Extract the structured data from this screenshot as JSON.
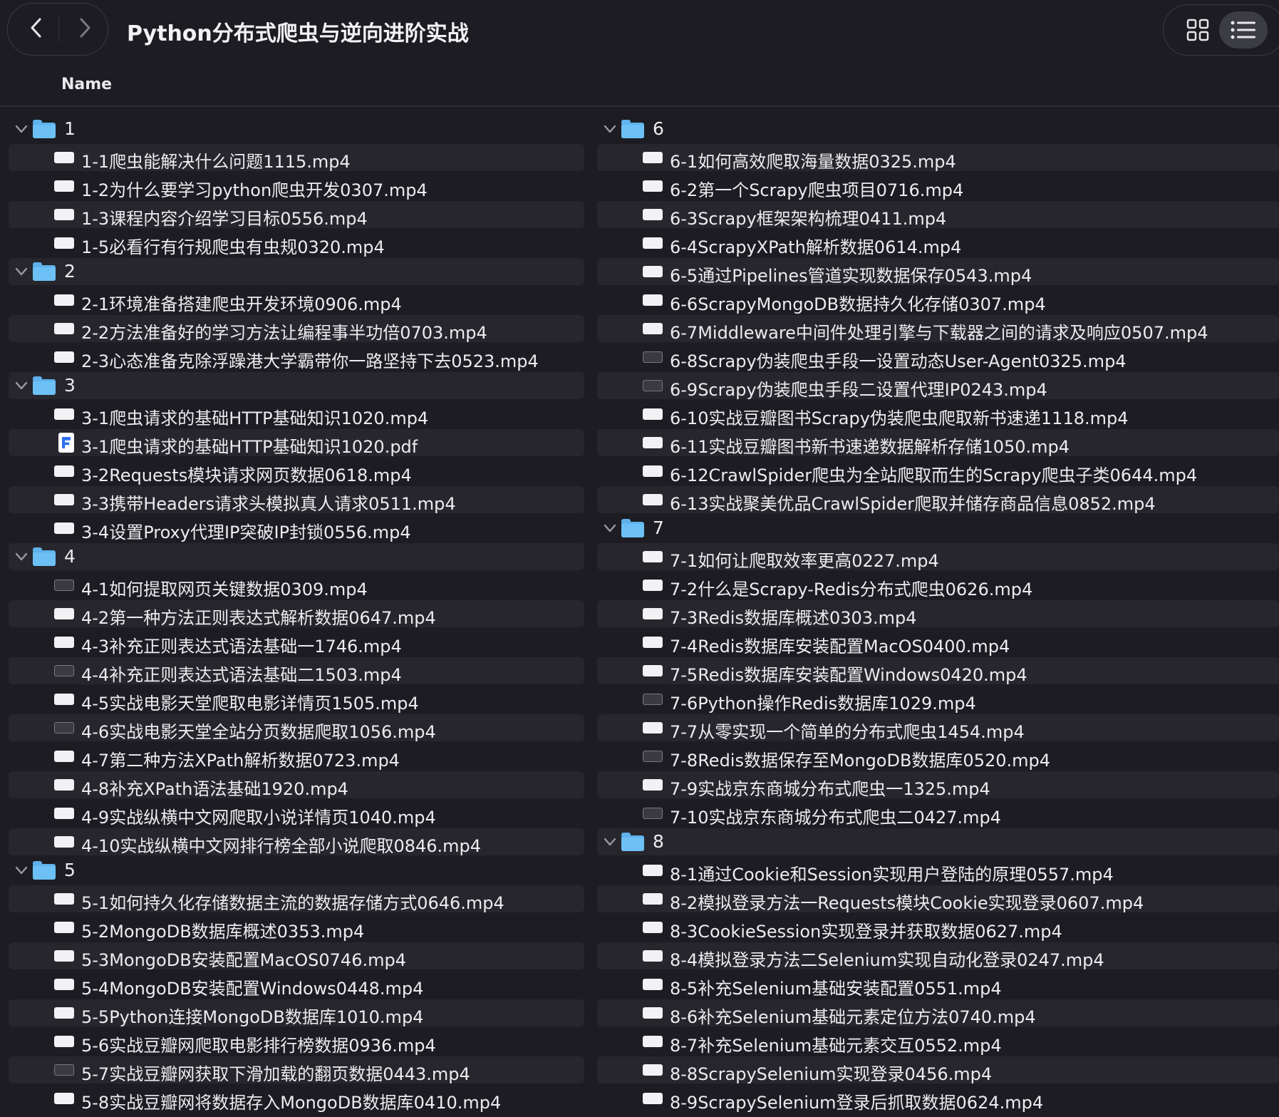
{
  "window": {
    "title": "Python分布式爬虫与逆向进阶实战"
  },
  "toolbar": {
    "back_icon": "chevron-left-icon",
    "forward_icon": "chevron-right-icon",
    "grid_view_icon": "grid-view-icon",
    "list_view_icon": "list-view-icon"
  },
  "columns": {
    "name": "Name"
  },
  "colors": {
    "folder": "#6cc0f5",
    "background": "#1c1c22",
    "row_alt": "#26262c"
  },
  "left_rows": [
    {
      "type": "folder",
      "label": "1"
    },
    {
      "type": "file",
      "label": "1-1爬虫能解决什么问题1115.mp4"
    },
    {
      "type": "file",
      "label": "1-2为什么要学习python爬虫开发0307.mp4"
    },
    {
      "type": "file",
      "label": "1-3课程内容介绍学习目标0556.mp4"
    },
    {
      "type": "file",
      "label": "1-5必看行有行规爬虫有虫规0320.mp4"
    },
    {
      "type": "folder",
      "label": "2"
    },
    {
      "type": "file",
      "label": "2-1环境准备搭建爬虫开发环境0906.mp4"
    },
    {
      "type": "file",
      "label": "2-2方法准备好的学习方法让编程事半功倍0703.mp4"
    },
    {
      "type": "file",
      "label": "2-3心态准备克除浮躁港大学霸带你一路坚持下去0523.mp4"
    },
    {
      "type": "folder",
      "label": "3"
    },
    {
      "type": "file",
      "label": "3-1爬虫请求的基础HTTP基础知识1020.mp4"
    },
    {
      "type": "pdf",
      "label": "3-1爬虫请求的基础HTTP基础知识1020.pdf"
    },
    {
      "type": "file",
      "label": "3-2Requests模块请求网页数据0618.mp4"
    },
    {
      "type": "file",
      "label": "3-3携带Headers请求头模拟真人请求0511.mp4"
    },
    {
      "type": "file",
      "label": "3-4设置Proxy代理IP突破IP封锁0556.mp4"
    },
    {
      "type": "folder",
      "label": "4"
    },
    {
      "type": "file-dark",
      "label": "4-1如何提取网页关键数据0309.mp4"
    },
    {
      "type": "file",
      "label": "4-2第一种方法正则表达式解析数据0647.mp4"
    },
    {
      "type": "file",
      "label": "4-3补充正则表达式语法基础一1746.mp4"
    },
    {
      "type": "file-dark",
      "label": "4-4补充正则表达式语法基础二1503.mp4"
    },
    {
      "type": "file",
      "label": "4-5实战电影天堂爬取电影详情页1505.mp4"
    },
    {
      "type": "file-dark",
      "label": "4-6实战电影天堂全站分页数据爬取1056.mp4"
    },
    {
      "type": "file",
      "label": "4-7第二种方法XPath解析数据0723.mp4"
    },
    {
      "type": "file",
      "label": "4-8补充XPath语法基础1920.mp4"
    },
    {
      "type": "file",
      "label": "4-9实战纵横中文网爬取小说详情页1040.mp4"
    },
    {
      "type": "file",
      "label": "4-10实战纵横中文网排行榜全部小说爬取0846.mp4"
    },
    {
      "type": "folder",
      "label": "5"
    },
    {
      "type": "file",
      "label": "5-1如何持久化存储数据主流的数据存储方式0646.mp4"
    },
    {
      "type": "file",
      "label": "5-2MongoDB数据库概述0353.mp4"
    },
    {
      "type": "file",
      "label": "5-3MongoDB安装配置MacOS0746.mp4"
    },
    {
      "type": "file",
      "label": "5-4MongoDB安装配置Windows0448.mp4"
    },
    {
      "type": "file",
      "label": "5-5Python连接MongoDB数据库1010.mp4"
    },
    {
      "type": "file",
      "label": "5-6实战豆瓣网爬取电影排行榜数据0936.mp4"
    },
    {
      "type": "file-dark",
      "label": "5-7实战豆瓣网获取下滑加载的翻页数据0443.mp4"
    },
    {
      "type": "file",
      "label": "5-8实战豆瓣网将数据存入MongoDB数据库0410.mp4"
    }
  ],
  "right_rows": [
    {
      "type": "folder",
      "label": "6"
    },
    {
      "type": "file",
      "label": "6-1如何高效爬取海量数据0325.mp4"
    },
    {
      "type": "file",
      "label": "6-2第一个Scrapy爬虫项目0716.mp4"
    },
    {
      "type": "file",
      "label": "6-3Scrapy框架架构梳理0411.mp4"
    },
    {
      "type": "file",
      "label": "6-4ScrapyXPath解析数据0614.mp4"
    },
    {
      "type": "file",
      "label": "6-5通过Pipelines管道实现数据保存0543.mp4"
    },
    {
      "type": "file",
      "label": "6-6ScrapyMongoDB数据持久化存储0307.mp4"
    },
    {
      "type": "file",
      "label": "6-7Middleware中间件处理引擎与下载器之间的请求及响应0507.mp4"
    },
    {
      "type": "file-dark",
      "label": "6-8Scrapy伪装爬虫手段一设置动态User-Agent0325.mp4"
    },
    {
      "type": "file-dark",
      "label": "6-9Scrapy伪装爬虫手段二设置代理IP0243.mp4"
    },
    {
      "type": "file",
      "label": "6-10实战豆瓣图书Scrapy伪装爬虫爬取新书速递1118.mp4"
    },
    {
      "type": "file",
      "label": "6-11实战豆瓣图书新书速递数据解析存储1050.mp4"
    },
    {
      "type": "file",
      "label": "6-12CrawlSpider爬虫为全站爬取而生的Scrapy爬虫子类0644.mp4"
    },
    {
      "type": "file",
      "label": "6-13实战聚美优品CrawlSpider爬取并储存商品信息0852.mp4"
    },
    {
      "type": "folder",
      "label": "7"
    },
    {
      "type": "file",
      "label": "7-1如何让爬取效率更高0227.mp4"
    },
    {
      "type": "file",
      "label": "7-2什么是Scrapy-Redis分布式爬虫0626.mp4"
    },
    {
      "type": "file",
      "label": "7-3Redis数据库概述0303.mp4"
    },
    {
      "type": "file",
      "label": "7-4Redis数据库安装配置MacOS0400.mp4"
    },
    {
      "type": "file",
      "label": "7-5Redis数据库安装配置Windows0420.mp4"
    },
    {
      "type": "file-dark",
      "label": "7-6Python操作Redis数据库1029.mp4"
    },
    {
      "type": "file",
      "label": "7-7从零实现一个简单的分布式爬虫1454.mp4"
    },
    {
      "type": "file-dark",
      "label": "7-8Redis数据保存至MongoDB数据库0520.mp4"
    },
    {
      "type": "file",
      "label": "7-9实战京东商城分布式爬虫一1325.mp4"
    },
    {
      "type": "file-dark",
      "label": "7-10实战京东商城分布式爬虫二0427.mp4"
    },
    {
      "type": "folder",
      "label": "8"
    },
    {
      "type": "file",
      "label": "8-1通过Cookie和Session实现用户登陆的原理0557.mp4"
    },
    {
      "type": "file",
      "label": "8-2模拟登录方法一Requests模块Cookie实现登录0607.mp4"
    },
    {
      "type": "file",
      "label": "8-3CookieSession实现登录并获取数据0627.mp4"
    },
    {
      "type": "file",
      "label": "8-4模拟登录方法二Selenium实现自动化登录0247.mp4"
    },
    {
      "type": "file",
      "label": "8-5补充Selenium基础安装配置0551.mp4"
    },
    {
      "type": "file",
      "label": "8-6补充Selenium基础元素定位方法0740.mp4"
    },
    {
      "type": "file",
      "label": "8-7补充Selenium基础元素交互0552.mp4"
    },
    {
      "type": "file",
      "label": "8-8ScrapySelenium实现登录0456.mp4"
    },
    {
      "type": "file",
      "label": "8-9ScrapySelenium登录后抓取数据0624.mp4"
    }
  ]
}
